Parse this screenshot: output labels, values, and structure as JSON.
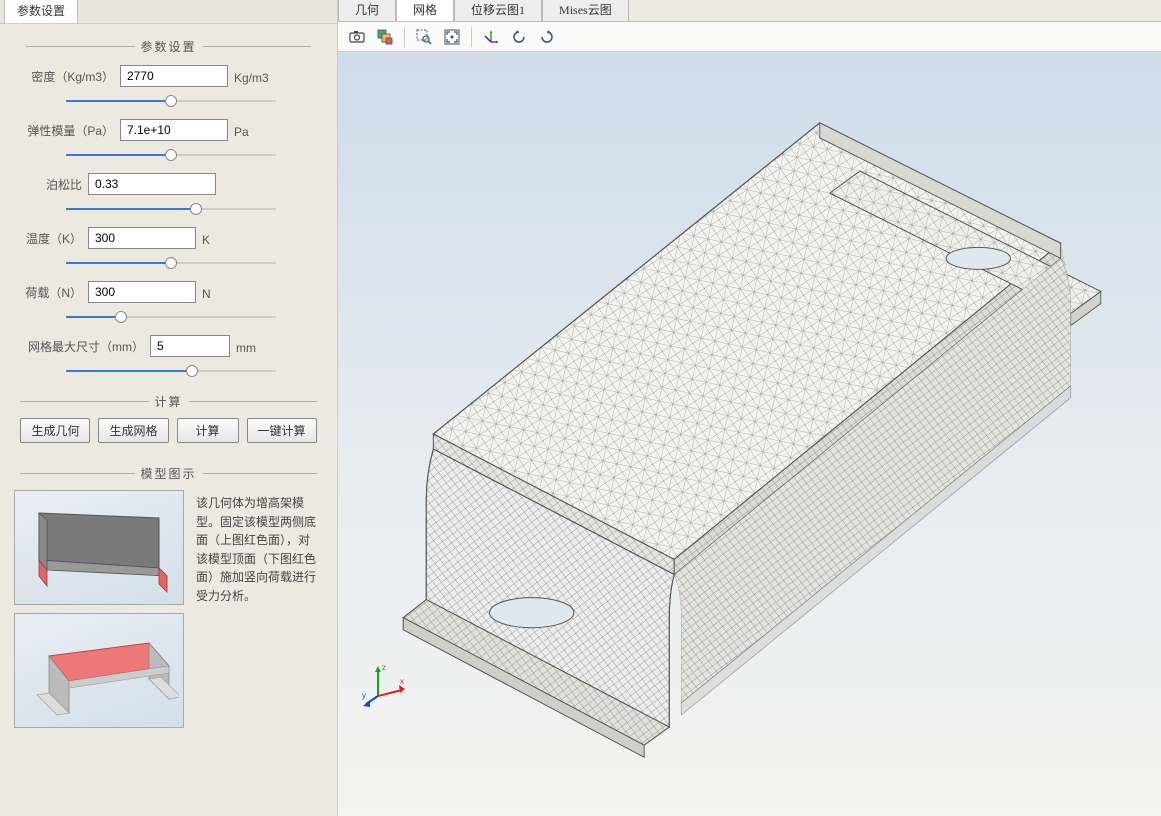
{
  "leftTab": {
    "label": "参数设置"
  },
  "sections": {
    "params_title": "参数设置",
    "compute_title": "计算",
    "model_title": "模型图示"
  },
  "params": {
    "density": {
      "label": "密度（Kg/m3）",
      "value": "2770",
      "unit": "Kg/m3",
      "slider_pct": 50
    },
    "modulus": {
      "label": "弹性模量（Pa）",
      "value": "7.1e+10",
      "unit": "Pa",
      "slider_pct": 50
    },
    "poisson": {
      "label": "泊松比",
      "value": "0.33",
      "unit": "",
      "slider_pct": 62
    },
    "temperature": {
      "label": "温度（K）",
      "value": "300",
      "unit": "K",
      "slider_pct": 50
    },
    "load": {
      "label": "荷载（N）",
      "value": "300",
      "unit": "N",
      "slider_pct": 26
    },
    "meshsize": {
      "label": "网格最大尺寸（mm）",
      "value": "5",
      "unit": "mm",
      "slider_pct": 60
    }
  },
  "buttons": {
    "gen_geom": "生成几何",
    "gen_mesh": "生成网格",
    "compute": "计算",
    "one_click": "一键计算"
  },
  "model_description": "该几何体为增高架模型。固定该模型两侧底面（上图红色面），对该模型顶面（下图红色面）施加竖向荷载进行受力分析。",
  "rightTabs": {
    "t1": "几何",
    "t2": "网格",
    "t3": "位移云图1",
    "t4": "Mises云图"
  },
  "toolbar_icons": {
    "camera": "camera-icon",
    "layers": "layers-icon",
    "zoom_select": "zoom-select-icon",
    "fit": "fit-icon",
    "axes": "axes-icon",
    "rotate_ccw": "rotate-ccw-icon",
    "rotate_cw": "rotate-cw-icon"
  }
}
